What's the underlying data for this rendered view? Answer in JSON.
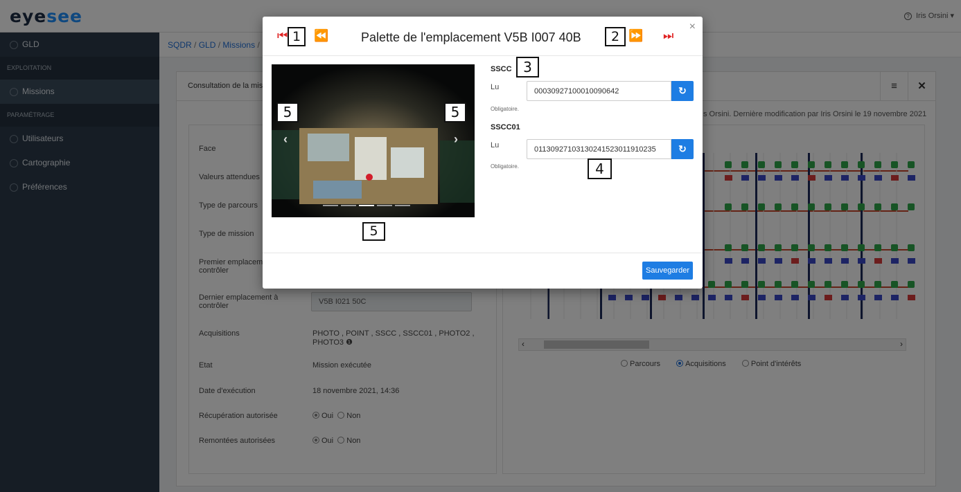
{
  "app": {
    "logo_prefix": "eye",
    "logo_suffix": "see",
    "user_name": "Iris Orsini ▾",
    "help_icon": "?"
  },
  "sidebar": {
    "items": [
      {
        "label": "GLD",
        "icon": "circle-icon"
      },
      {
        "section": "EXPLOITATION"
      },
      {
        "label": "Missions",
        "icon": "eye-icon"
      },
      {
        "section": "PARAMÉTRAGE"
      },
      {
        "label": "Utilisateurs",
        "icon": "user-icon"
      },
      {
        "label": "Cartographie",
        "icon": "map-icon"
      },
      {
        "label": "Préférences",
        "icon": "gear-icon"
      }
    ]
  },
  "breadcrumb": {
    "parts": [
      "SQDR",
      "GLD",
      "Missions",
      ""
    ]
  },
  "card": {
    "title": "Consultation de la mis",
    "modif_info": "s Orsini. Dernière modification par Iris Orsini le 19 novembre 2021"
  },
  "form": {
    "face": "Face",
    "valeurs": "Valeurs attendues",
    "type_parcours": "Type de parcours",
    "type_mission": "Type de mission",
    "premier_l1": "Premier emplaceme",
    "premier_l2": "contrôler",
    "dernier_l1": "Dernier emplacement à",
    "dernier_l2": "contrôler",
    "dernier_value": "V5B I021 50C",
    "acq_label": "Acquisitions",
    "acq_value_l1": "PHOTO , POINT , SSCC , SSCC01 , PHOTO2 ,",
    "acq_value_l2": "PHOTO3 ❶",
    "etat_label": "Etat",
    "etat_value": "Mission exécutée",
    "date_label": "Date d'exécution",
    "date_value": "18 novembre 2021, 14:36",
    "recup_label": "Récupération autorisée",
    "remont_label": "Remontées autorisées",
    "oui": "Oui",
    "non": "Non"
  },
  "map": {
    "radio_parcours": "Parcours",
    "radio_acq": "Acquisitions",
    "radio_points": "Point d'intérêts",
    "selected": "Acquisitions",
    "colors": {
      "cell_green": "#2ea84a",
      "barcode_blue": "#3b49c9",
      "barcode_red": "#d93a3a",
      "barcode_green": "#58b24e",
      "rack_red": "#c8472c",
      "rack_navy": "#1d2a5b"
    }
  },
  "modal": {
    "title": "Palette de l'emplacement V5B I007 40B",
    "close": "×",
    "first_icon": "⏮",
    "prev_icon": "⏪",
    "next_icon": "⏩",
    "last_icon": "⏭",
    "markers": {
      "m1": "1",
      "m2": "2",
      "m3": "3",
      "m4": "4",
      "m5": "5"
    },
    "chev_left": "‹",
    "chev_right": "›",
    "sscc_title": "SSCC",
    "sscc_label": "Lu",
    "sscc_value": "00030927100010090642",
    "sscc_help": "Obligatoire.",
    "sscc01_title": "SSCC01",
    "sscc01_label": "Lu",
    "sscc01_value": "01130927103130241523011910235",
    "sscc01_help": "Obligatoire.",
    "refresh_icon": "↻",
    "save_label": "Sauvegarder",
    "carousel_count": 5,
    "carousel_active": 3
  }
}
